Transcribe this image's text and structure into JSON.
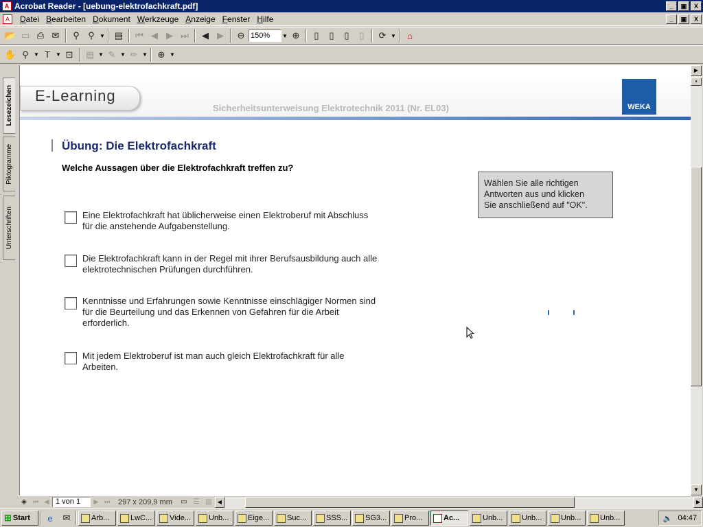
{
  "window": {
    "title": "Acrobat Reader - [uebung-elektrofachkraft.pdf]",
    "min": "_",
    "max": "▣",
    "close": "X"
  },
  "menubar": {
    "items": [
      "Datei",
      "Bearbeiten",
      "Dokument",
      "Werkzeuge",
      "Anzeige",
      "Fenster",
      "Hilfe"
    ]
  },
  "toolbar": {
    "zoom": "150%"
  },
  "sidebar": {
    "tabs": [
      "Lesezeichen",
      "Piktogramme",
      "Unterschriften"
    ]
  },
  "document": {
    "logo": "E-Learning",
    "subtitle": "Sicherheitsunterweisung Elektrotechnik 2011 (Nr. EL03)",
    "brand": "WEKA",
    "exercise_title": "Übung: Die Elektrofachkraft",
    "question": "Welche Aussagen über die Elektrofachkraft treffen zu?",
    "options": [
      {
        "line1": "Eine Elektrofachkraft hat üblicherweise einen Elektroberuf mit Abschluss",
        "line2": "für die anstehende Aufgabenstellung.",
        "line3": ""
      },
      {
        "line1": "Die Elektrofachkraft kann in der Regel mit ihrer Berufsausbildung auch alle",
        "line2": "elektrotechnischen Prüfungen durchführen.",
        "line3": ""
      },
      {
        "line1": "Kenntnisse und Erfahrungen sowie Kenntnisse einschlägiger Normen sind",
        "line2": "für die Beurteilung und das Erkennen von Gefahren für die Arbeit",
        "line3": "erforderlich."
      },
      {
        "line1": "Mit jedem Elektroberuf ist man auch gleich Elektrofachkraft für alle",
        "line2": "Arbeiten.",
        "line3": ""
      }
    ],
    "hint": {
      "line1": "Wählen Sie alle richtigen",
      "line2": "Antworten aus und klicken",
      "line3": "Sie anschließend auf \"OK\"."
    }
  },
  "statusbar": {
    "page": "1 von 1",
    "size": "297 x 209,9 mm"
  },
  "taskbar": {
    "start": "Start",
    "tasks": [
      "Arb...",
      "LwC...",
      "Vide...",
      "Unb...",
      "Eige...",
      "Suc...",
      "SSS...",
      "SG3...",
      "Pro...",
      "Ac...",
      "Unb...",
      "Unb...",
      "Unb...",
      "Unb..."
    ],
    "active_index": 9,
    "clock": "04:47"
  }
}
